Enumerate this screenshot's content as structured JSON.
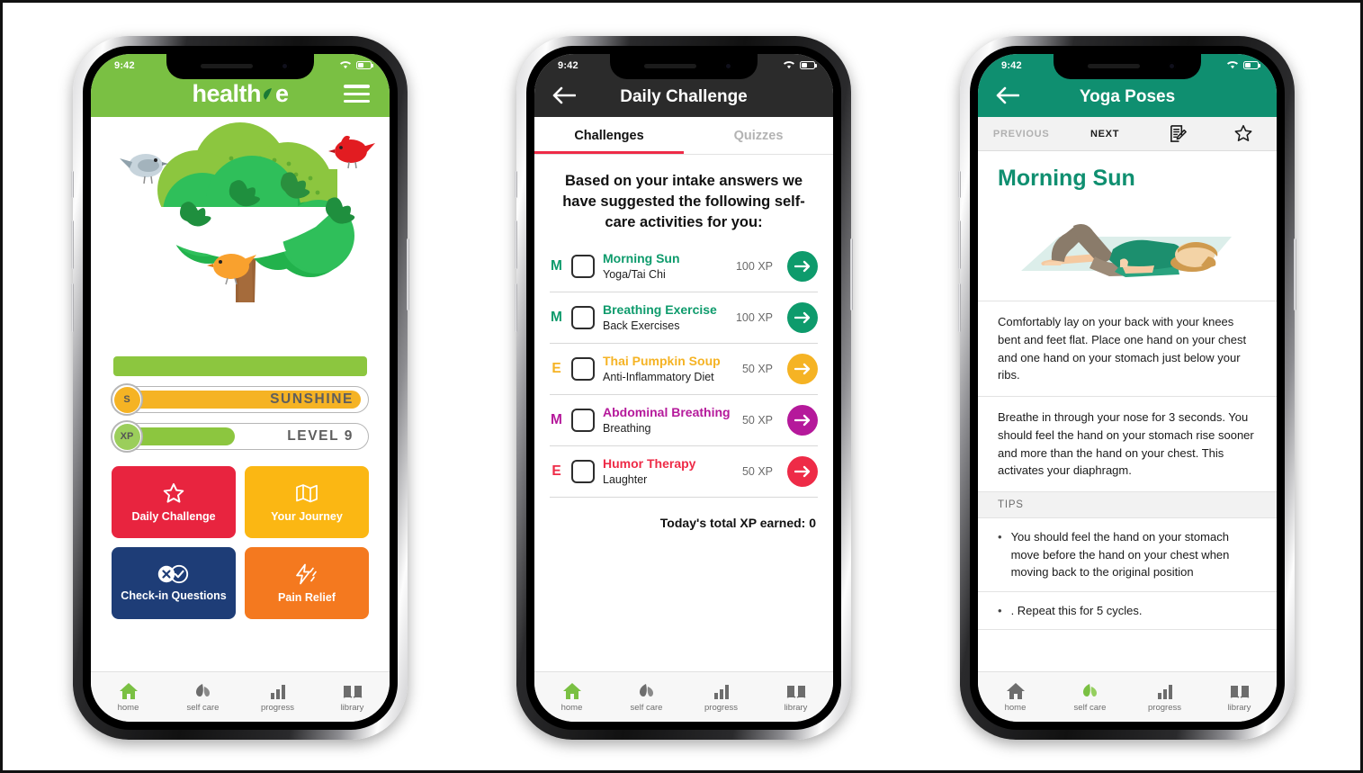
{
  "colors": {
    "brand_green": "#7ac043",
    "teal": "#0f8f70",
    "amber": "#f5b324",
    "red": "#ee2b47",
    "purple": "#b5199b",
    "navy": "#1e3d77",
    "orange": "#f4791f",
    "dark_header": "#2b2b2b",
    "leaf_green": "#8cc63f"
  },
  "phone1": {
    "status": {
      "time": "9:42",
      "wifi_icon": "wifi-icon",
      "battery_icon": "battery-icon"
    },
    "header": {
      "logo_text_a": "health",
      "logo_text_b": "e",
      "leaf_icon": "leaf-icon",
      "menu_icon": "hamburger-menu-icon"
    },
    "illustration": {
      "name": "tree-illustration",
      "birds": [
        "grey-bird",
        "red-bird",
        "orange-bird"
      ]
    },
    "bars": [
      {
        "badge": "S",
        "label": "SUNSHINE",
        "fill_percent": 100,
        "fill_color": "#f5b324",
        "badge_color": "#f5b324"
      },
      {
        "badge": "XP",
        "label": "LEVEL 9",
        "fill_percent": 45,
        "fill_color": "#8cc63f",
        "badge_color": "#9bce5b"
      }
    ],
    "tiles": [
      {
        "label": "Daily Challenge",
        "color": "#e8243f",
        "icon": "star-icon"
      },
      {
        "label": "Your Journey",
        "color": "#fbb713",
        "icon": "map-icon"
      },
      {
        "label": "Check-in Questions",
        "color": "#1e3d77",
        "icon": "check-x-icon"
      },
      {
        "label": "Pain Relief",
        "color": "#f4791f",
        "icon": "lightning-bolt-icon"
      }
    ],
    "nav": [
      {
        "label": "home",
        "icon": "home-icon",
        "active": true
      },
      {
        "label": "self care",
        "icon": "leaf-icon",
        "active": false
      },
      {
        "label": "progress",
        "icon": "bar-chart-icon",
        "active": false
      },
      {
        "label": "library",
        "icon": "book-icon",
        "active": false
      }
    ]
  },
  "phone2": {
    "status": {
      "time": "9:42",
      "wifi_icon": "wifi-icon",
      "battery_icon": "battery-icon"
    },
    "header": {
      "title": "Daily Challenge",
      "back_icon": "back-arrow-icon"
    },
    "tabs": [
      {
        "label": "Challenges",
        "active": true
      },
      {
        "label": "Quizzes",
        "active": false
      }
    ],
    "intro": "Based on your intake answers we have suggested the following self-care activities for you:",
    "activities": [
      {
        "mark": "M",
        "title": "Morning Sun",
        "subtitle": "Yoga/Tai Chi",
        "xp": "100 XP",
        "color": "#0e9b6c",
        "checked": false
      },
      {
        "mark": "M",
        "title": "Breathing Exercise",
        "subtitle": "Back Exercises",
        "xp": "100 XP",
        "color": "#0e9b6c",
        "checked": false
      },
      {
        "mark": "E",
        "title": "Thai Pumpkin Soup",
        "subtitle": "Anti-Inflammatory Diet",
        "xp": "50 XP",
        "color": "#f5b324",
        "checked": false
      },
      {
        "mark": "M",
        "title": "Abdominal Breathing",
        "subtitle": "Breathing",
        "xp": "50 XP",
        "color": "#b5199b",
        "checked": false
      },
      {
        "mark": "E",
        "title": "Humor Therapy",
        "subtitle": "Laughter",
        "xp": "50 XP",
        "color": "#ee2b47",
        "checked": false
      }
    ],
    "total_text": "Today's total XP earned: 0",
    "nav": [
      {
        "label": "home",
        "icon": "home-icon",
        "active": true
      },
      {
        "label": "self care",
        "icon": "leaf-icon",
        "active": false
      },
      {
        "label": "progress",
        "icon": "bar-chart-icon",
        "active": false
      },
      {
        "label": "library",
        "icon": "book-icon",
        "active": false
      }
    ]
  },
  "phone3": {
    "status": {
      "time": "9:42",
      "wifi_icon": "wifi-icon",
      "battery_icon": "battery-icon"
    },
    "header": {
      "title": "Yoga Poses",
      "back_icon": "back-arrow-icon"
    },
    "toolbar": {
      "previous": "PREVIOUS",
      "next": "NEXT",
      "note_icon": "note-edit-icon",
      "star_icon": "star-outline-icon"
    },
    "pose_title": "Morning Sun",
    "illustration": {
      "name": "yoga-pose-illustration",
      "description": "person lying on back with knees bent on a mat"
    },
    "paragraphs": [
      "Comfortably lay on your back with your knees bent and feet flat. Place one hand on your chest and one hand on your stomach just below your ribs.",
      "Breathe in through your nose for 3 seconds. You should feel the hand on your stomach rise sooner and more than the hand on your chest. This activates your diaphragm."
    ],
    "tips_header": "TIPS",
    "tips": [
      "You should feel the hand on your stomach move before the hand on your chest when moving back to the original position",
      ". Repeat this for 5 cycles."
    ],
    "nav": [
      {
        "label": "home",
        "icon": "home-icon",
        "active": false
      },
      {
        "label": "self care",
        "icon": "leaf-icon",
        "active": true
      },
      {
        "label": "progress",
        "icon": "bar-chart-icon",
        "active": false
      },
      {
        "label": "library",
        "icon": "book-icon",
        "active": false
      }
    ]
  }
}
